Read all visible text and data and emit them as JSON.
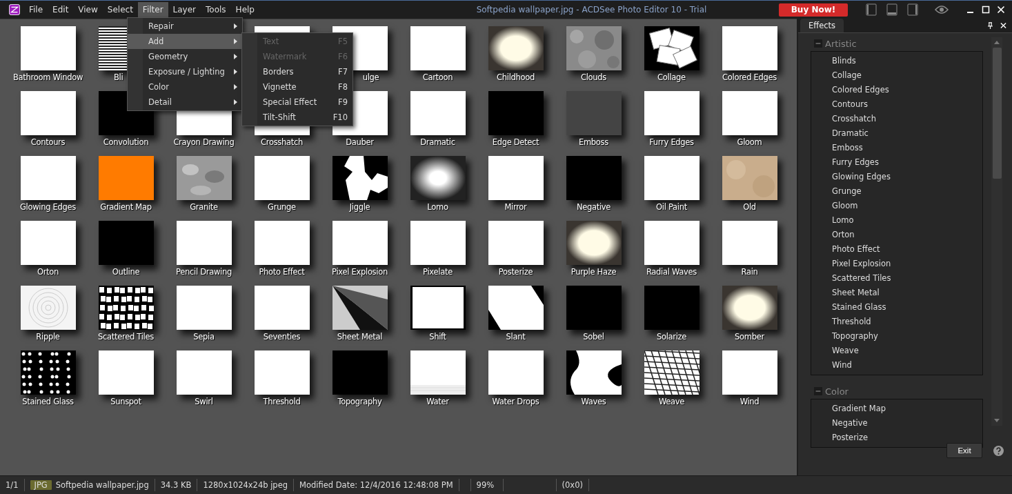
{
  "window": {
    "title": "Softpedia wallpaper.jpg - ACDSee Photo Editor 10 - Trial",
    "buy_button": "Buy Now!"
  },
  "menu_bar": [
    {
      "label": "File",
      "selected": false
    },
    {
      "label": "Edit",
      "selected": false
    },
    {
      "label": "View",
      "selected": false
    },
    {
      "label": "Select",
      "selected": false
    },
    {
      "label": "Filter",
      "selected": true
    },
    {
      "label": "Layer",
      "selected": false
    },
    {
      "label": "Tools",
      "selected": false
    },
    {
      "label": "Help",
      "selected": false
    }
  ],
  "filter_menu": [
    {
      "label": "Repair",
      "selected": false
    },
    {
      "label": "Add",
      "selected": true
    },
    {
      "label": "Geometry",
      "selected": false
    },
    {
      "label": "Exposure / Lighting",
      "selected": false
    },
    {
      "label": "Color",
      "selected": false
    },
    {
      "label": "Detail",
      "selected": false
    }
  ],
  "add_menu": [
    {
      "label": "Text",
      "shortcut": "F5",
      "disabled": true
    },
    {
      "label": "Watermark",
      "shortcut": "F6",
      "disabled": true
    },
    {
      "label": "Borders",
      "shortcut": "F7",
      "disabled": false
    },
    {
      "label": "Vignette",
      "shortcut": "F8",
      "disabled": false
    },
    {
      "label": "Special Effect",
      "shortcut": "F9",
      "disabled": false
    },
    {
      "label": "Tilt-Shift",
      "shortcut": "F10",
      "disabled": false
    }
  ],
  "thumbnails": [
    {
      "label": "Bathroom Window",
      "kind": "white"
    },
    {
      "label": "Bli",
      "kind": "stripes"
    },
    {
      "kind": "hidden"
    },
    {
      "kind": "white"
    },
    {
      "label": "ulge",
      "kind": "white"
    },
    {
      "label": "Cartoon",
      "kind": "white"
    },
    {
      "label": "Childhood",
      "kind": "glow"
    },
    {
      "label": "Clouds",
      "kind": "noise"
    },
    {
      "label": "Collage",
      "kind": "collage"
    },
    {
      "label": "Colored Edges",
      "kind": "white"
    },
    {
      "label": "Contours",
      "kind": "white"
    },
    {
      "label": "Convolution",
      "kind": "black"
    },
    {
      "label": "Crayon Drawing",
      "kind": "white"
    },
    {
      "label": "Crosshatch",
      "kind": "white"
    },
    {
      "label": "Dauber",
      "kind": "white"
    },
    {
      "label": "Dramatic",
      "kind": "white"
    },
    {
      "label": "Edge Detect",
      "kind": "black"
    },
    {
      "label": "Emboss",
      "kind": "gray"
    },
    {
      "label": "Furry Edges",
      "kind": "white"
    },
    {
      "label": "Gloom",
      "kind": "white"
    },
    {
      "label": "Glowing Edges",
      "kind": "white"
    },
    {
      "label": "Gradient Map",
      "kind": "orange"
    },
    {
      "label": "Granite",
      "kind": "granite"
    },
    {
      "label": "Grunge",
      "kind": "white"
    },
    {
      "label": "Jiggle",
      "kind": "jiggle"
    },
    {
      "label": "Lomo",
      "kind": "lomo"
    },
    {
      "label": "Mirror",
      "kind": "white"
    },
    {
      "label": "Negative",
      "kind": "black"
    },
    {
      "label": "Oil Paint",
      "kind": "white"
    },
    {
      "label": "Old",
      "kind": "sand"
    },
    {
      "label": "Orton",
      "kind": "white"
    },
    {
      "label": "Outline",
      "kind": "black"
    },
    {
      "label": "Pencil Drawing",
      "kind": "white"
    },
    {
      "label": "Photo Effect",
      "kind": "white"
    },
    {
      "label": "Pixel Explosion",
      "kind": "white"
    },
    {
      "label": "Pixelate",
      "kind": "white"
    },
    {
      "label": "Posterize",
      "kind": "white"
    },
    {
      "label": "Purple Haze",
      "kind": "glow"
    },
    {
      "label": "Radial Waves",
      "kind": "white"
    },
    {
      "label": "Rain",
      "kind": "white"
    },
    {
      "label": "Ripple",
      "kind": "rings"
    },
    {
      "label": "Scattered Tiles",
      "kind": "tiles"
    },
    {
      "label": "Sepia",
      "kind": "white"
    },
    {
      "label": "Seventies",
      "kind": "white"
    },
    {
      "label": "Sheet Metal",
      "kind": "sheet"
    },
    {
      "label": "Shift",
      "kind": "shift"
    },
    {
      "label": "Slant",
      "kind": "slant"
    },
    {
      "label": "Sobel",
      "kind": "black"
    },
    {
      "label": "Solarize",
      "kind": "black"
    },
    {
      "label": "Somber",
      "kind": "glow"
    },
    {
      "label": "Stained Glass",
      "kind": "cells"
    },
    {
      "label": "Sunspot",
      "kind": "white"
    },
    {
      "label": "Swirl",
      "kind": "white"
    },
    {
      "label": "Threshold",
      "kind": "white"
    },
    {
      "label": "Topography",
      "kind": "black"
    },
    {
      "label": "Water",
      "kind": "water"
    },
    {
      "label": "Water Drops",
      "kind": "white"
    },
    {
      "label": "Waves",
      "kind": "waves"
    },
    {
      "label": "Weave",
      "kind": "weave"
    },
    {
      "label": "Wind",
      "kind": "white"
    }
  ],
  "effects_panel": {
    "tab": "Effects",
    "groups": [
      {
        "title": "Artistic",
        "expanded": true,
        "items": [
          "Blinds",
          "Collage",
          "Colored Edges",
          "Contours",
          "Crosshatch",
          "Dramatic",
          "Emboss",
          "Furry Edges",
          "Glowing Edges",
          "Grunge",
          "Gloom",
          "Lomo",
          "Orton",
          "Photo Effect",
          "Pixel Explosion",
          "Scattered Tiles",
          "Sheet Metal",
          "Stained Glass",
          "Threshold",
          "Topography",
          "Weave",
          "Wind"
        ]
      },
      {
        "title": "Color",
        "expanded": true,
        "items": [
          "Gradient Map",
          "Negative",
          "Posterize"
        ]
      }
    ],
    "exit_button": "Exit"
  },
  "status_bar": {
    "index": "1/1",
    "format": "JPG",
    "file": "Softpedia wallpaper.jpg",
    "size": "34.3 KB",
    "dimensions": "1280x1024x24b jpeg",
    "modified": "Modified Date: 12/4/2016 12:48:08 PM",
    "zoom": "99%",
    "selection": "(0x0)"
  }
}
